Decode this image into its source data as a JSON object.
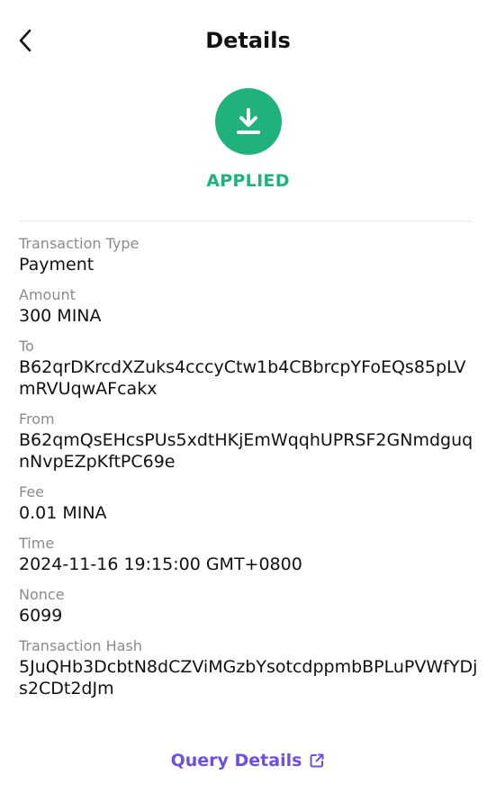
{
  "header": {
    "title": "Details"
  },
  "status": {
    "text": "APPLIED",
    "icon": "download-icon",
    "color": "#1fb27d"
  },
  "fields": [
    {
      "label": "Transaction Type",
      "value": "Payment"
    },
    {
      "label": "Amount",
      "value": "300 MINA"
    },
    {
      "label": "To",
      "value": "B62qrDKrcdXZuks4cccyCtw1b4CBbrcpYFoEQs85pLVmRVUqwAFcakx"
    },
    {
      "label": "From",
      "value": "B62qmQsEHcsPUs5xdtHKjEmWqqhUPRSF2GNmdguqnNvpEZpKftPC69e"
    },
    {
      "label": "Fee",
      "value": "0.01 MINA"
    },
    {
      "label": "Time",
      "value": "2024-11-16 19:15:00 GMT+0800"
    },
    {
      "label": "Nonce",
      "value": "6099"
    },
    {
      "label": "Transaction Hash",
      "value": "5JuQHb3DcbtN8dCZViMGzbYsotcdppmbBPLuPVWfYDjs2CDt2dJm"
    }
  ],
  "footer": {
    "link_label": "Query Details",
    "icon": "external-link-icon",
    "color": "#6c4fe6"
  }
}
